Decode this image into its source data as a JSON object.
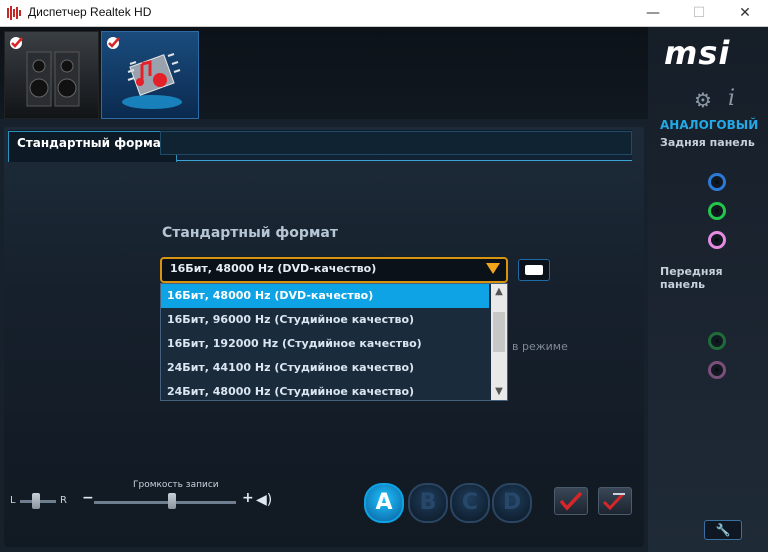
{
  "window": {
    "title": "Диспетчер Realtek HD",
    "min_glyph": "—",
    "max_glyph": "☐",
    "close_glyph": "✕"
  },
  "devices": [
    {
      "name": "speakers",
      "checked": true,
      "active": false
    },
    {
      "name": "microphone",
      "checked": true,
      "active": true
    }
  ],
  "tab": {
    "label": "Стандартный формат"
  },
  "format": {
    "section_label": "Стандартный формат",
    "selected": "16Бит, 48000 Hz (DVD-качество)",
    "options": [
      "16Бит, 48000 Hz (DVD-качество)",
      "16Бит, 96000 Hz (Студийное качество)",
      "16Бит, 192000 Hz (Студийное качество)",
      "24Бит, 44100 Hz (Студийное качество)",
      "24Бит, 48000 Hz (Студийное качество)"
    ],
    "partial_hidden_text": "в режиме"
  },
  "volume": {
    "label": "Громкость записи",
    "left": "L",
    "right": "R",
    "minus": "−",
    "plus": "+",
    "speaker_glyph": "◀)"
  },
  "channels": {
    "a": "A",
    "b": "B",
    "c": "C",
    "d": "D"
  },
  "right_panel": {
    "logo": "msi",
    "analog": "АНАЛОГОВЫЙ",
    "rear_panel": "Задняя панель",
    "front_panel": "Передняя панель",
    "gear_glyph": "⚙",
    "info_glyph": "i",
    "wrench_glyph": "🔧"
  },
  "colors": {
    "accent": "#0ea3e5",
    "select_border": "#d8930f",
    "jack_blue": "#2b7ad6",
    "jack_green": "#21c64a",
    "jack_pink": "#e58be0"
  }
}
